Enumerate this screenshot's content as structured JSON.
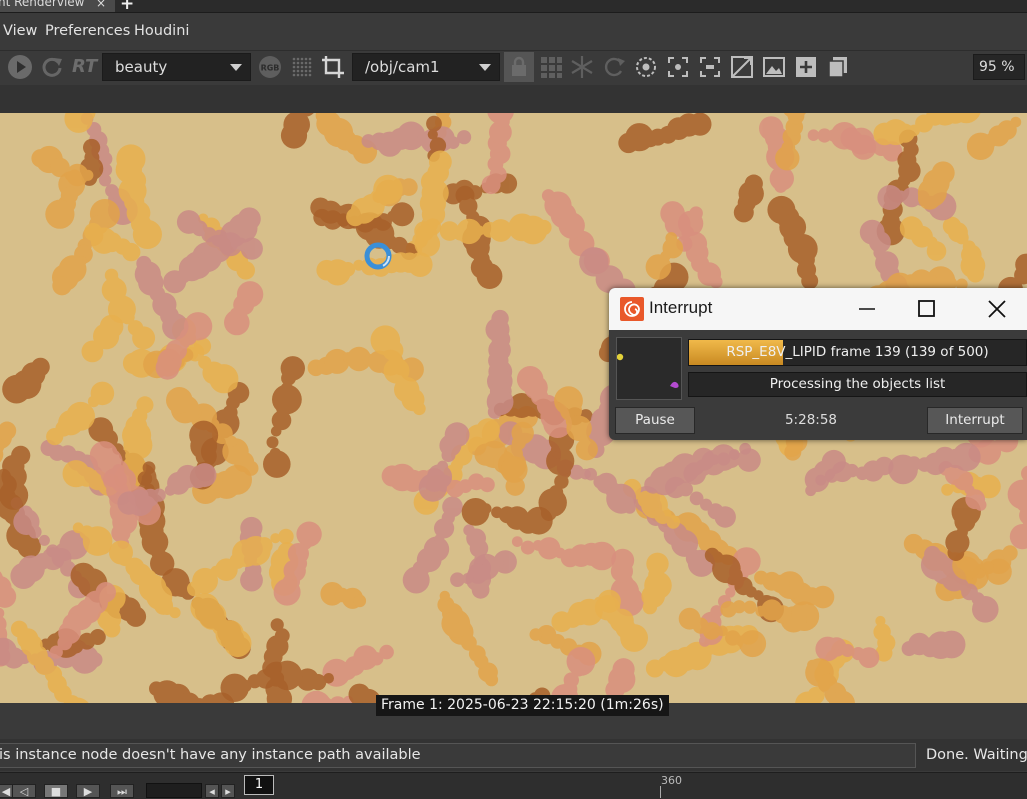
{
  "tab": {
    "label": "nt Renderview",
    "close_glyph": "×",
    "add_glyph": "+"
  },
  "menu": {
    "items": [
      "View",
      "Preferences",
      "Houdini"
    ]
  },
  "toolbar": {
    "rt_label": "RT",
    "aov_value": "beauty",
    "rgb_label": "RGB",
    "camera_value": "/obj/cam1",
    "zoom": "95 %"
  },
  "render": {
    "frame_caption": "Frame  1:  2025-06-23  22:15:20  (1m:26s)",
    "background_color": "#d7bf8a",
    "molecule_colors": [
      "#e2a34a",
      "#d9907e",
      "#a8602a",
      "#c98b86",
      "#e8b04e"
    ]
  },
  "status": {
    "message": "is instance node doesn't have any instance path available",
    "right_text": "Done. Waiting E"
  },
  "timeline": {
    "current_frame": "1",
    "tick_label": "360"
  },
  "dialog": {
    "title": "Interrupt",
    "progress_text": "RSP_E8V_LIPID frame 139 (139 of 500)",
    "progress_fraction": 0.278,
    "status_text": "Processing the objects list",
    "pause_label": "Pause",
    "elapsed": "5:28:58",
    "interrupt_label": "Interrupt"
  },
  "colors": {
    "accent": "#f0b94a",
    "spinner": "#3a8fd8",
    "houdini_logo": "#e9582a"
  }
}
